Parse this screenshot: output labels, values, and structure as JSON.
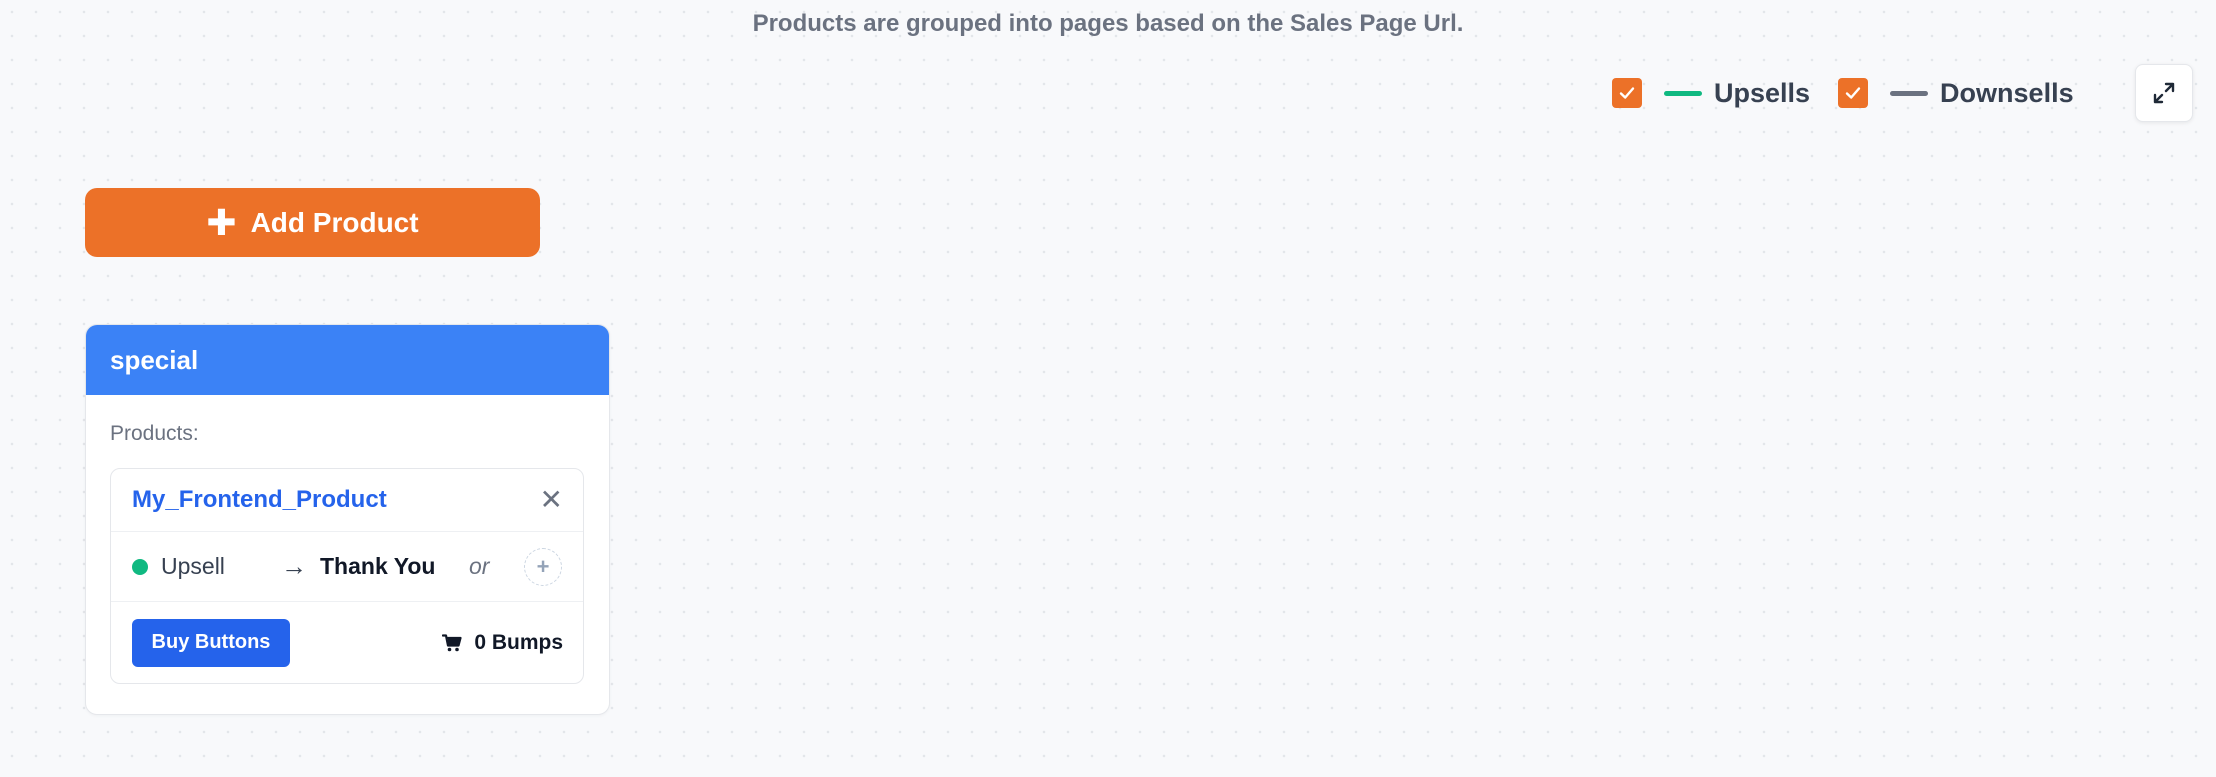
{
  "hint_text": "Products are grouped into pages based on the Sales Page Url.",
  "legend": {
    "items": [
      {
        "label": "Upsells",
        "checked": true,
        "color": "#10b981"
      },
      {
        "label": "Downsells",
        "checked": true,
        "color": "#6b7280"
      }
    ]
  },
  "toolbar": {
    "expand_icon": "expand-icon",
    "add_product_label": "Add Product"
  },
  "page": {
    "title": "special",
    "products_label": "Products:",
    "product": {
      "name": "My_Frontend_Product",
      "flow_type": "Upsell",
      "flow_arrow": "→",
      "flow_target": "Thank You",
      "or_label": "or",
      "add_icon": "+",
      "buy_buttons_label": "Buy Buttons",
      "bumps_label": "0 Bumps"
    }
  },
  "colors": {
    "accent": "#ec7128",
    "page_header": "#3b82f6",
    "link": "#2563eb",
    "upsell_dot": "#10b981"
  }
}
